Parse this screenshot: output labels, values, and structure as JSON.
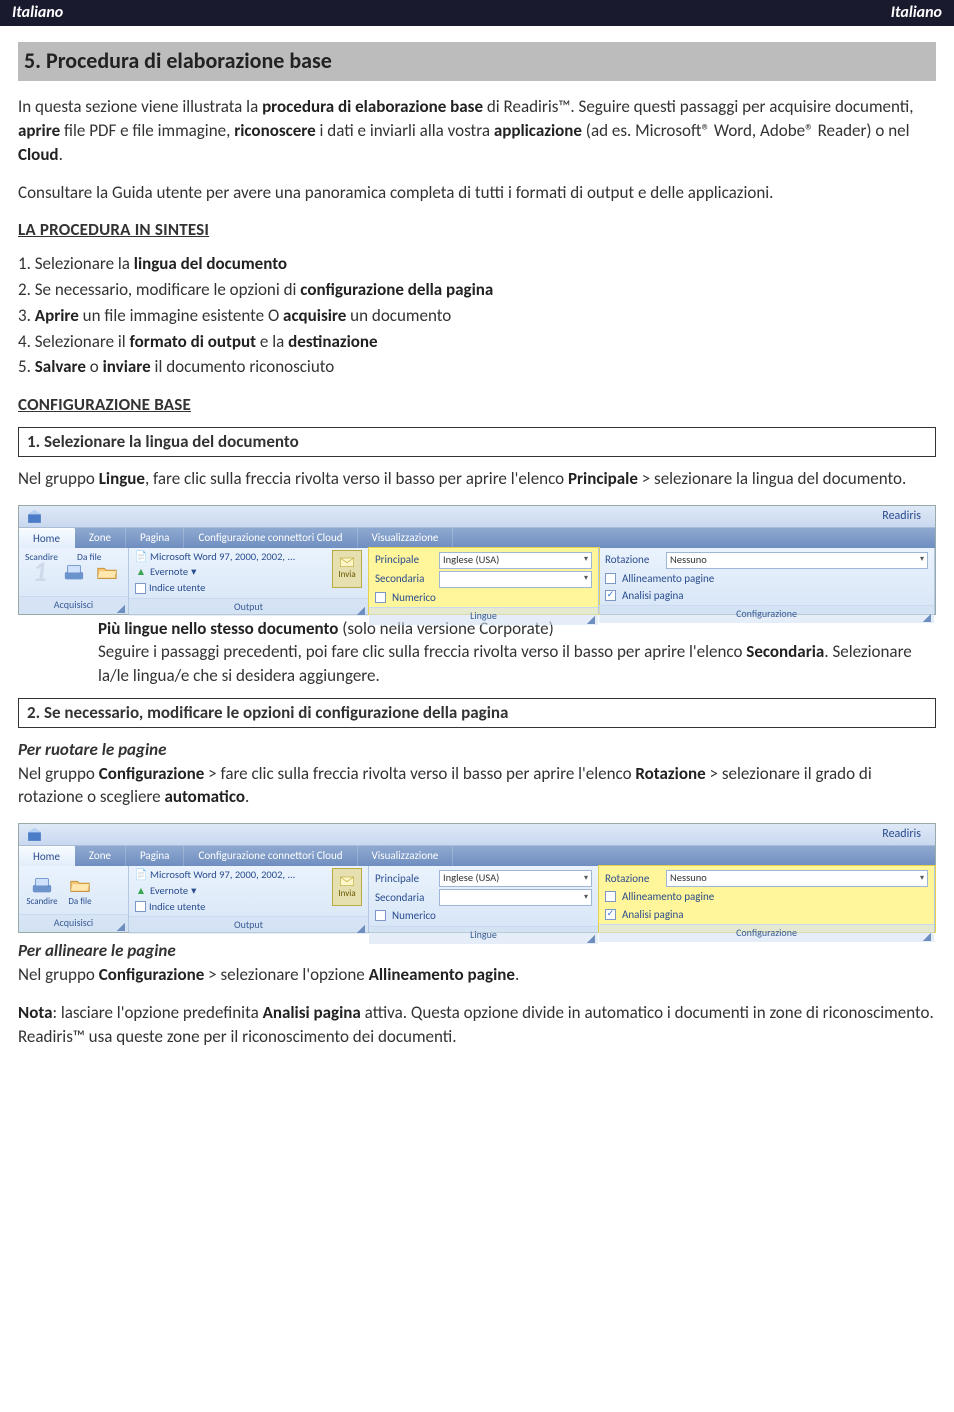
{
  "header": {
    "left": "Italiano",
    "right": "Italiano"
  },
  "title": "5. Procedura di elaborazione base",
  "intro": {
    "p1a": "In questa sezione viene illustrata la ",
    "p1b": "procedura di elaborazione base",
    "p1c": " di Readiris™. Seguire questi passaggi per acquisire documenti, ",
    "p1d": "aprire",
    "p1e": " file PDF e file immagine, ",
    "p1f": "riconoscere",
    "p1g": " i dati e inviarli alla vostra ",
    "p1h": "applicazione",
    "p1i": " (ad es. Microsoft® Word, Adobe® Reader) o nel ",
    "p1j": "Cloud",
    "p1k": ".",
    "p2": "Consultare la Guida utente per avere una panoramica completa di tutti i formati di output e delle applicazioni."
  },
  "sintesi_head": "LA PROCEDURA IN SINTESI ",
  "steps": {
    "s1a": "1. Selezionare la ",
    "s1b": "lingua del documento",
    "s2a": "2. Se necessario, modificare le opzioni di ",
    "s2b": "configurazione della pagina",
    "s3a": "3. ",
    "s3b": "Aprire",
    "s3c": " un file immagine esistente O ",
    "s3d": "acquisire",
    "s3e": " un documento",
    "s4a": "4. Selezionare il ",
    "s4b": "formato di output",
    "s4c": " e la ",
    "s4d": "destinazione",
    "s5a": "5. ",
    "s5b": "Salvare",
    "s5c": "  o ",
    "s5d": "inviare",
    "s5e": " il documento riconosciuto"
  },
  "conf_head": "CONFIGURAZIONE BASE",
  "box1": "1. Selezionare la lingua del documento",
  "para1a": "Nel gruppo ",
  "para1b": "Lingue",
  "para1c": ", fare clic sulla freccia rivolta verso il basso per aprire l'elenco ",
  "para1d": "Principale",
  "para1e": " > selezionare la lingua del documento.",
  "ribbon": {
    "app_title": "Readiris",
    "tabs": {
      "home": "Home",
      "zone": "Zone",
      "pagina": "Pagina",
      "conn": "Configurazione connettori Cloud",
      "visual": "Visualizzazione"
    },
    "acquire": {
      "scan": "Scandire",
      "from": "Da file",
      "group": "Acquisisci"
    },
    "output_group": "Output",
    "out_items": {
      "word": "Microsoft Word 97, 2000, 2002, ...",
      "evernote": "Evernote",
      "indice": "Indice utente"
    },
    "invia": "Invia",
    "lingue_group": "Lingue",
    "principale": "Principale",
    "principale_val": "Inglese (USA)",
    "secondaria": "Secondaria",
    "numerico": "Numerico",
    "conf_group": "Configurazione",
    "rotazione": "Rotazione",
    "rotazione_val": "Nessuno",
    "allineamento": "Allineamento pagine",
    "analisi": "Analisi pagina"
  },
  "after1": {
    "b1": "Più lingue nello stesso documento",
    "b1t": " (solo nella versione Corporate)",
    "p": "Seguire i passaggi precedenti, poi fare clic sulla freccia rivolta verso il basso per aprire l'elenco ",
    "pb": "Secondaria",
    "p2": ". Selezionare la/le lingua/e che si desidera aggiungere."
  },
  "box2": "2. Se necessario, modificare le opzioni di configurazione della pagina",
  "rot_head": "Per ruotare le pagine",
  "rot_p": {
    "a": "Nel gruppo ",
    "b": "Configurazione",
    "c": " > fare clic sulla freccia rivolta verso il basso per aprire l'elenco ",
    "d": "Rotazione",
    "e": " > selezionare il grado di rotazione o scegliere ",
    "f": "automatico",
    "g": "."
  },
  "align_head": "Per allineare le pagine",
  "align_p": {
    "a": "Nel gruppo ",
    "b": "Configurazione",
    "c": " > selezionare l'opzione ",
    "d": "Allineamento pagine",
    "e": "."
  },
  "nota": {
    "a": "Nota",
    "b": ": lasciare l'opzione predefinita ",
    "c": "Analisi pagina",
    "d": " attiva. Questa opzione divide in automatico i documenti in zone di riconoscimento. Readiris™ usa queste zone per il riconoscimento dei documenti."
  }
}
